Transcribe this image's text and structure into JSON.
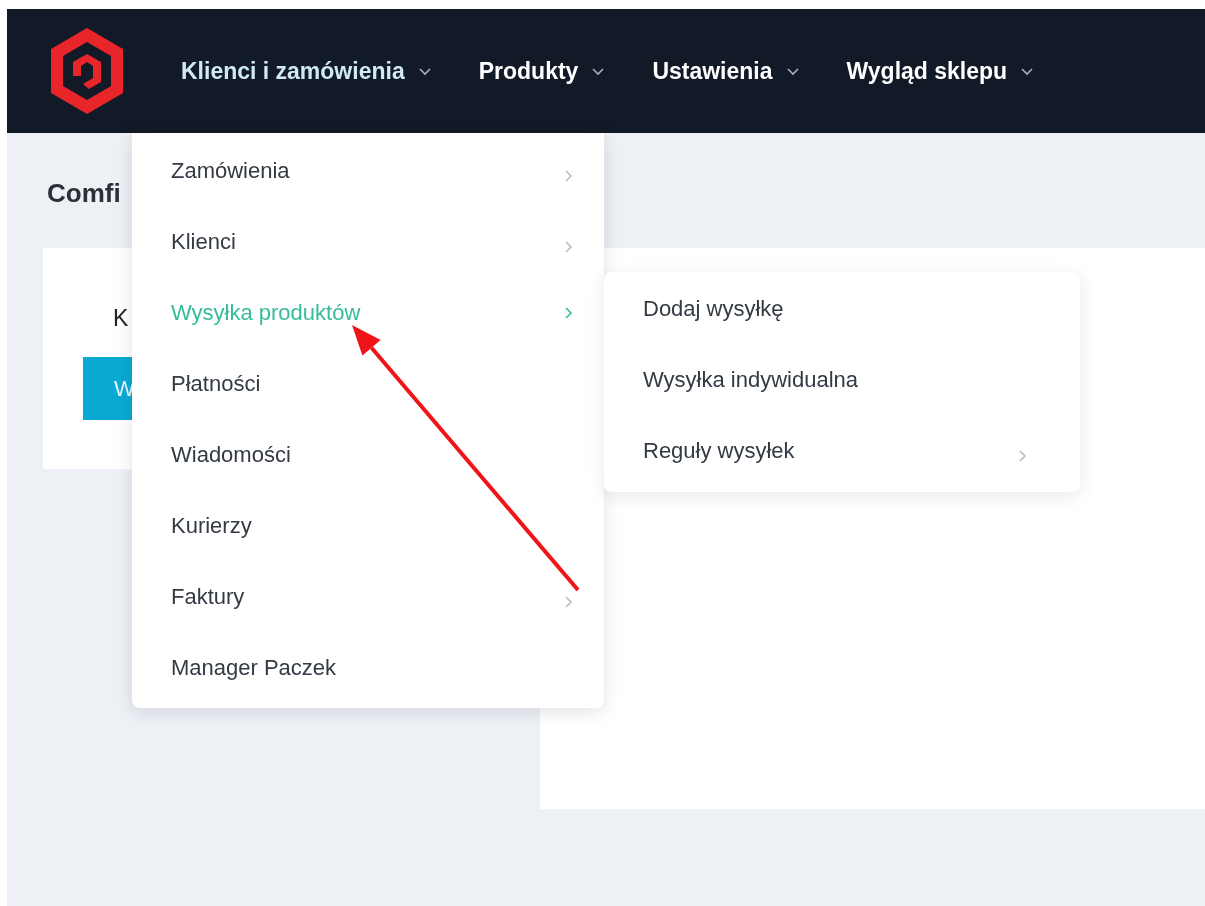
{
  "nav": {
    "items": [
      {
        "label": "Klienci i zamówienia",
        "selected": true
      },
      {
        "label": "Produkty",
        "selected": false
      },
      {
        "label": "Ustawienia",
        "selected": false
      },
      {
        "label": "Wygląd sklepu",
        "selected": false
      }
    ]
  },
  "page": {
    "heading": "Comfi",
    "card_text": "K",
    "card_button": "W"
  },
  "menu": {
    "items": [
      {
        "label": "Zamówienia",
        "selected": false,
        "has_submenu": true
      },
      {
        "label": "Klienci",
        "selected": false,
        "has_submenu": true
      },
      {
        "label": "Wysyłka produktów",
        "selected": true,
        "has_submenu": true
      },
      {
        "label": "Płatności",
        "selected": false,
        "has_submenu": false
      },
      {
        "label": "Wiadomości",
        "selected": false,
        "has_submenu": false
      },
      {
        "label": "Kurierzy",
        "selected": false,
        "has_submenu": false
      },
      {
        "label": "Faktury",
        "selected": false,
        "has_submenu": true
      },
      {
        "label": "Manager Paczek",
        "selected": false,
        "has_submenu": false
      }
    ]
  },
  "submenu": {
    "items": [
      {
        "label": "Dodaj wysyłkę",
        "selected": false,
        "has_submenu": false
      },
      {
        "label": "Wysyłka indywidualna",
        "selected": false,
        "has_submenu": false
      },
      {
        "label": "Reguły wysyłek",
        "selected": false,
        "has_submenu": true
      }
    ]
  }
}
